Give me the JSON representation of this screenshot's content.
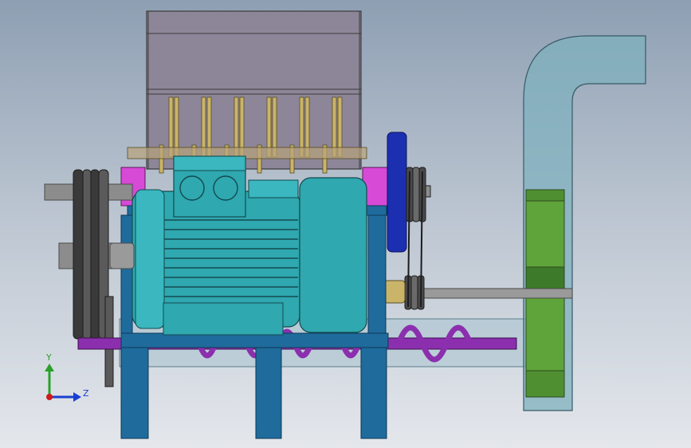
{
  "triad": {
    "y_label": "Y",
    "z_label": "Z",
    "y_color": "#2aa12a",
    "z_color": "#1a3fd0",
    "origin_color": "#d01818"
  },
  "colors": {
    "hopper": "#8d8698",
    "hopper_frame": "#3b3b3b",
    "blade": "#c9b46a",
    "motor": "#2fa8b0",
    "motor_dark": "#217b83",
    "frame": "#1f6b9c",
    "bearing": "#d64ad6",
    "pulley": "#3a3a3a",
    "flywheel": "#1c2fb0",
    "screw": "#8b2fae",
    "fan": "#5fa43a",
    "duct": "#89b3bd",
    "shaft": "#8c8c8c"
  }
}
